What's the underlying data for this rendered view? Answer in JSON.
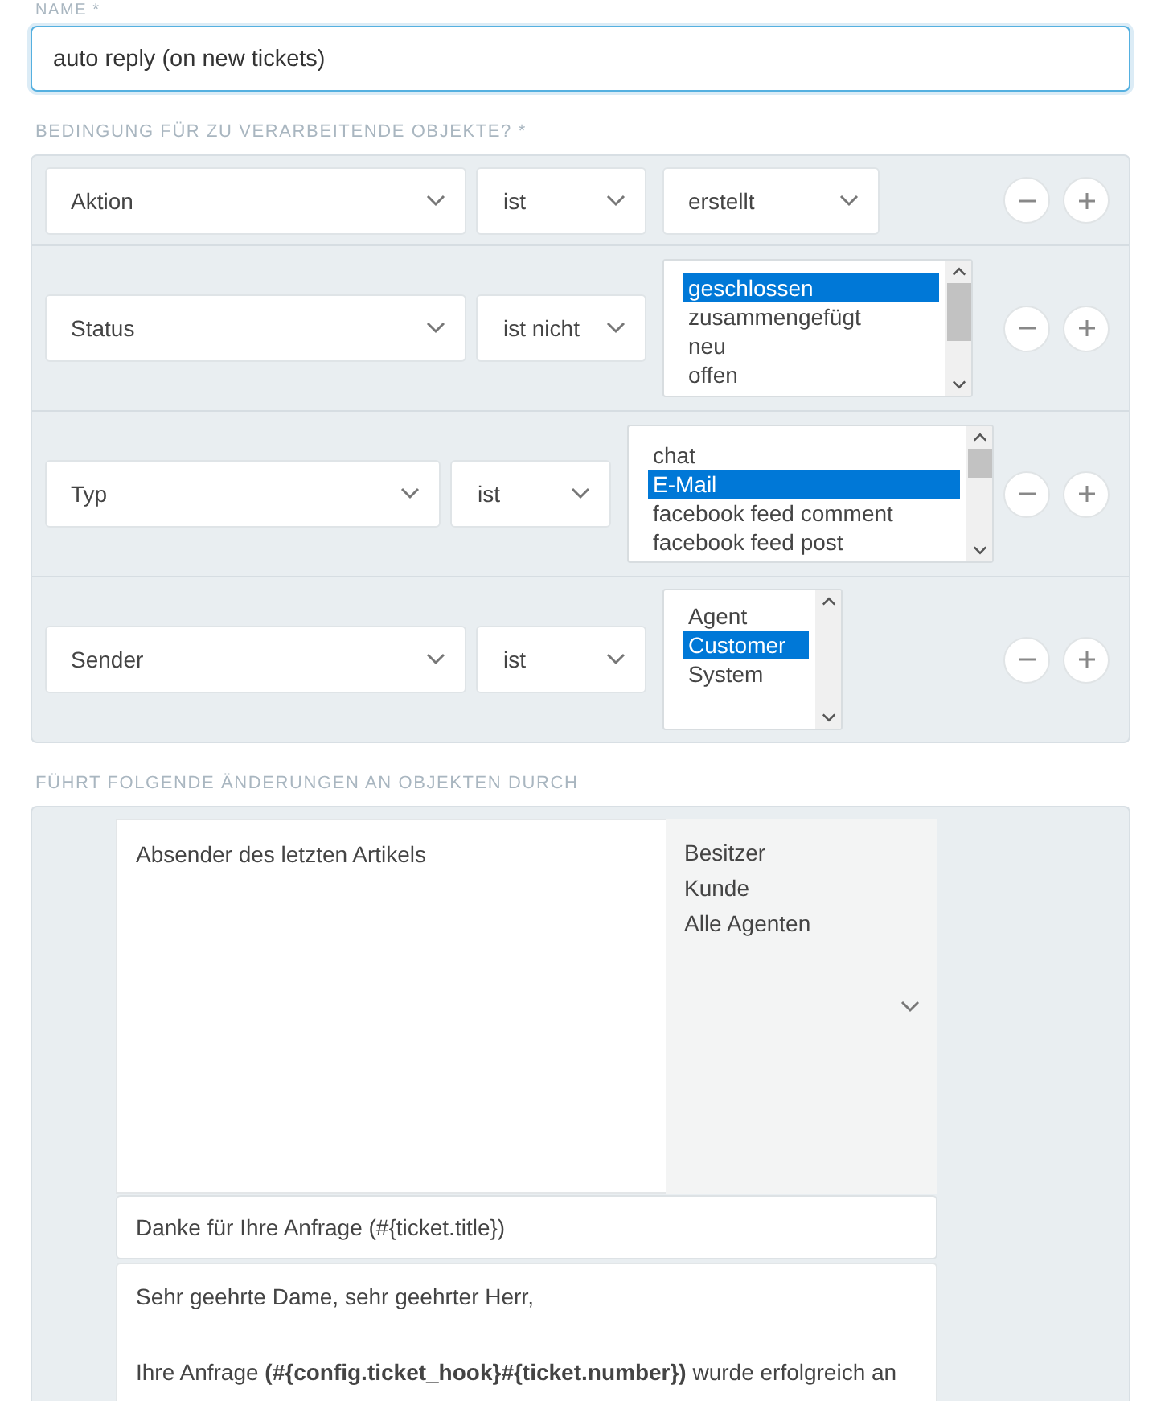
{
  "name": {
    "label": "NAME *",
    "value": "auto reply (on new tickets)"
  },
  "conditions": {
    "label": "BEDINGUNG FÜR ZU VERARBEITENDE OBJEKTE? *",
    "rows": [
      {
        "attribute": "Aktion",
        "operator": "ist",
        "value": {
          "kind": "select",
          "text": "erstellt"
        }
      },
      {
        "attribute": "Status",
        "operator": "ist nicht",
        "value": {
          "kind": "listbox",
          "options": [
            {
              "label": "geschlossen",
              "selected": true
            },
            {
              "label": "zusammengefügt",
              "selected": false
            },
            {
              "label": "neu",
              "selected": false
            },
            {
              "label": "offen",
              "selected": false
            }
          ]
        }
      },
      {
        "attribute": "Typ",
        "operator": "ist",
        "value": {
          "kind": "listbox",
          "options": [
            {
              "label": "chat",
              "selected": false
            },
            {
              "label": "E-Mail",
              "selected": true
            },
            {
              "label": "facebook feed comment",
              "selected": false
            },
            {
              "label": "facebook feed post",
              "selected": false
            }
          ]
        }
      },
      {
        "attribute": "Sender",
        "operator": "ist",
        "value": {
          "kind": "listbox",
          "options": [
            {
              "label": "Agent",
              "selected": false
            },
            {
              "label": "Customer",
              "selected": true
            },
            {
              "label": "System",
              "selected": false
            }
          ]
        }
      }
    ]
  },
  "actions": {
    "label": "FÜHRT FOLGENDE ÄNDERUNGEN AN OBJEKTEN DURCH",
    "chosen_recipients": [
      "Absender des letzten Artikels"
    ],
    "available_recipients": [
      "Besitzer",
      "Kunde",
      "Alle Agenten"
    ],
    "subject": "Danke für Ihre Anfrage (#{ticket.title})",
    "body": [
      "Sehr geehrte Dame, sehr geehrter Herr,",
      "Ihre Anfrage **(#{config.ticket_hook}#{ticket.number})** wurde erfolgreich an"
    ]
  }
}
